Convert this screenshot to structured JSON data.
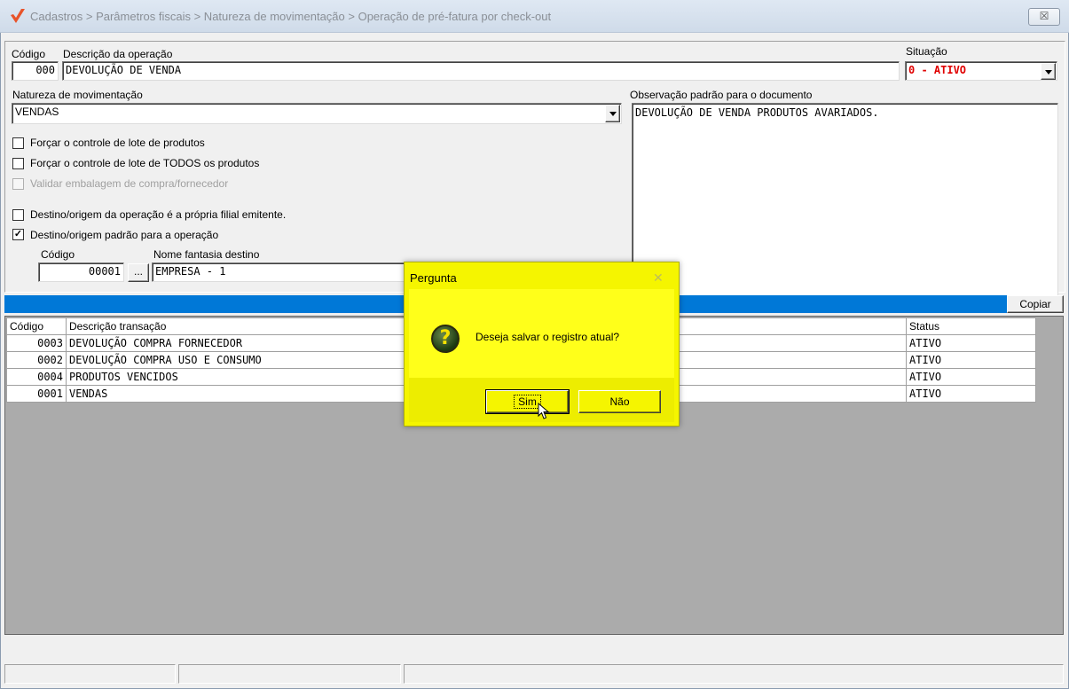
{
  "window": {
    "title": "Cadastros > Parâmetros fiscais > Natureza de movimentação > Operação de pré-fatura por check-out",
    "close_glyph": "☒"
  },
  "form": {
    "codigo_label": "Código",
    "codigo_value": "000",
    "descricao_label": "Descrição da operação",
    "descricao_value": "DEVOLUÇÃO DE VENDA",
    "situacao_label": "Situação",
    "situacao_value": "0 - ATIVO",
    "situacao_color": "#e00000",
    "natureza_label": "Natureza de movimentação",
    "natureza_value": "VENDAS",
    "observacao_label": "Observação padrão para o documento",
    "observacao_value": "DEVOLUÇÃO DE VENDA PRODUTOS AVARIADOS.",
    "checkboxes": [
      {
        "label": "Forçar o controle de lote de produtos",
        "checked": false,
        "disabled": false,
        "mark": ""
      },
      {
        "label": "Forçar o controle de lote de TODOS os produtos",
        "checked": false,
        "disabled": false,
        "mark": ""
      },
      {
        "label": "Validar embalagem de compra/fornecedor",
        "checked": false,
        "disabled": true,
        "mark": ""
      },
      {
        "label": "Destino/origem da operação é a própria filial emitente.",
        "checked": false,
        "disabled": false,
        "mark": ""
      },
      {
        "label": "Destino/origem padrão para a operação",
        "checked": true,
        "disabled": false,
        "mark": "✓"
      }
    ],
    "destino_codigo_label": "Código",
    "destino_codigo_value": "00001",
    "destino_lookup_label": "...",
    "destino_nome_label": "Nome fantasia destino",
    "destino_nome_value": "EMPRESA - 1"
  },
  "toolbar": {
    "copiar_label": "Copiar"
  },
  "grid": {
    "columns": [
      "Código",
      "Descrição  transação",
      "Status"
    ],
    "rows": [
      {
        "codigo": "0003",
        "descricao": "DEVOLUÇÃO COMPRA FORNECEDOR",
        "status": "ATIVO"
      },
      {
        "codigo": "0002",
        "descricao": "DEVOLUÇÃO COMPRA USO E CONSUMO",
        "status": "ATIVO"
      },
      {
        "codigo": "0004",
        "descricao": "PRODUTOS VENCIDOS",
        "status": "ATIVO"
      },
      {
        "codigo": "0001",
        "descricao": "VENDAS",
        "status": "ATIVO"
      }
    ]
  },
  "dialog": {
    "title": "Pergunta",
    "close_glyph": "✕",
    "icon": "question-icon",
    "icon_glyph": "?",
    "message": "Deseja salvar o registro atual?",
    "yes_label": "Sim",
    "no_label": "Não",
    "bg_color": "#f5f500"
  }
}
